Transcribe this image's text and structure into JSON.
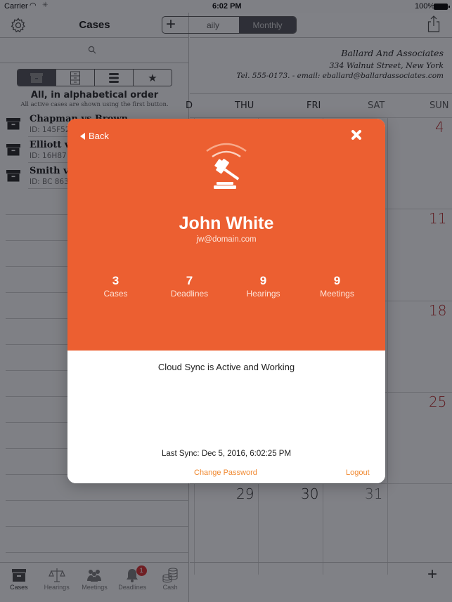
{
  "status_bar": {
    "carrier": "Carrier",
    "time": "6:02 PM",
    "battery": "100%"
  },
  "master": {
    "title": "Cases",
    "search_placeholder": "",
    "filter_segments": [
      {
        "icon": "archive-box-icon",
        "active": true
      },
      {
        "icon": "file-cabinet-icon",
        "active": false
      },
      {
        "icon": "list-icon",
        "active": false
      },
      {
        "icon": "star-icon",
        "active": false
      }
    ],
    "order_title": "All, in alphabetical order",
    "order_subtitle": "All active cases are shown using the first button.",
    "cases": [
      {
        "name": "Chapman vs Brown",
        "id": "ID: 145F52"
      },
      {
        "name": "Elliott vs",
        "id": "ID: 16H87"
      },
      {
        "name": "Smith vs",
        "id": "ID: BC 863"
      }
    ]
  },
  "tabbar": {
    "tabs": [
      {
        "label": "Cases",
        "icon": "archive-box-icon",
        "active": true
      },
      {
        "label": "Hearings",
        "icon": "scales-icon",
        "active": false
      },
      {
        "label": "Meetings",
        "icon": "people-icon",
        "active": false
      },
      {
        "label": "Deadlines",
        "icon": "bell-icon",
        "active": false,
        "badge": "1"
      },
      {
        "label": "Cash",
        "icon": "coins-icon",
        "active": false
      }
    ]
  },
  "detail": {
    "view_modes": [
      {
        "label": "Daily",
        "visible_label": "aily",
        "active": false
      },
      {
        "label": "Monthly",
        "active": true
      }
    ],
    "letterhead": {
      "firm": "Ballard And Associates",
      "address": "334 Walnut Street, New York",
      "contact": "Tel. 555-0173. -  email: eballard@ballardassociates.com"
    },
    "weekdays": [
      "THU",
      "FRI",
      "SAT",
      "SUN"
    ],
    "sunday_dates": [
      "4",
      "11",
      "18",
      "25"
    ],
    "last_row_dates": [
      "29",
      "30",
      "31"
    ]
  },
  "modal": {
    "back_label": "Back",
    "user_name": "John White",
    "user_email": "jw@domain.com",
    "stats": [
      {
        "value": "3",
        "label": "Cases"
      },
      {
        "value": "7",
        "label": "Deadlines"
      },
      {
        "value": "9",
        "label": "Hearings"
      },
      {
        "value": "9",
        "label": "Meetings"
      }
    ],
    "sync_status": "Cloud Sync is Active and Working",
    "last_sync": "Last Sync: Dec 5, 2016, 6:02:25 PM",
    "change_password_label": "Change Password",
    "logout_label": "Logout",
    "colors": {
      "header": "#ec5f31",
      "link": "#f0882f"
    }
  }
}
